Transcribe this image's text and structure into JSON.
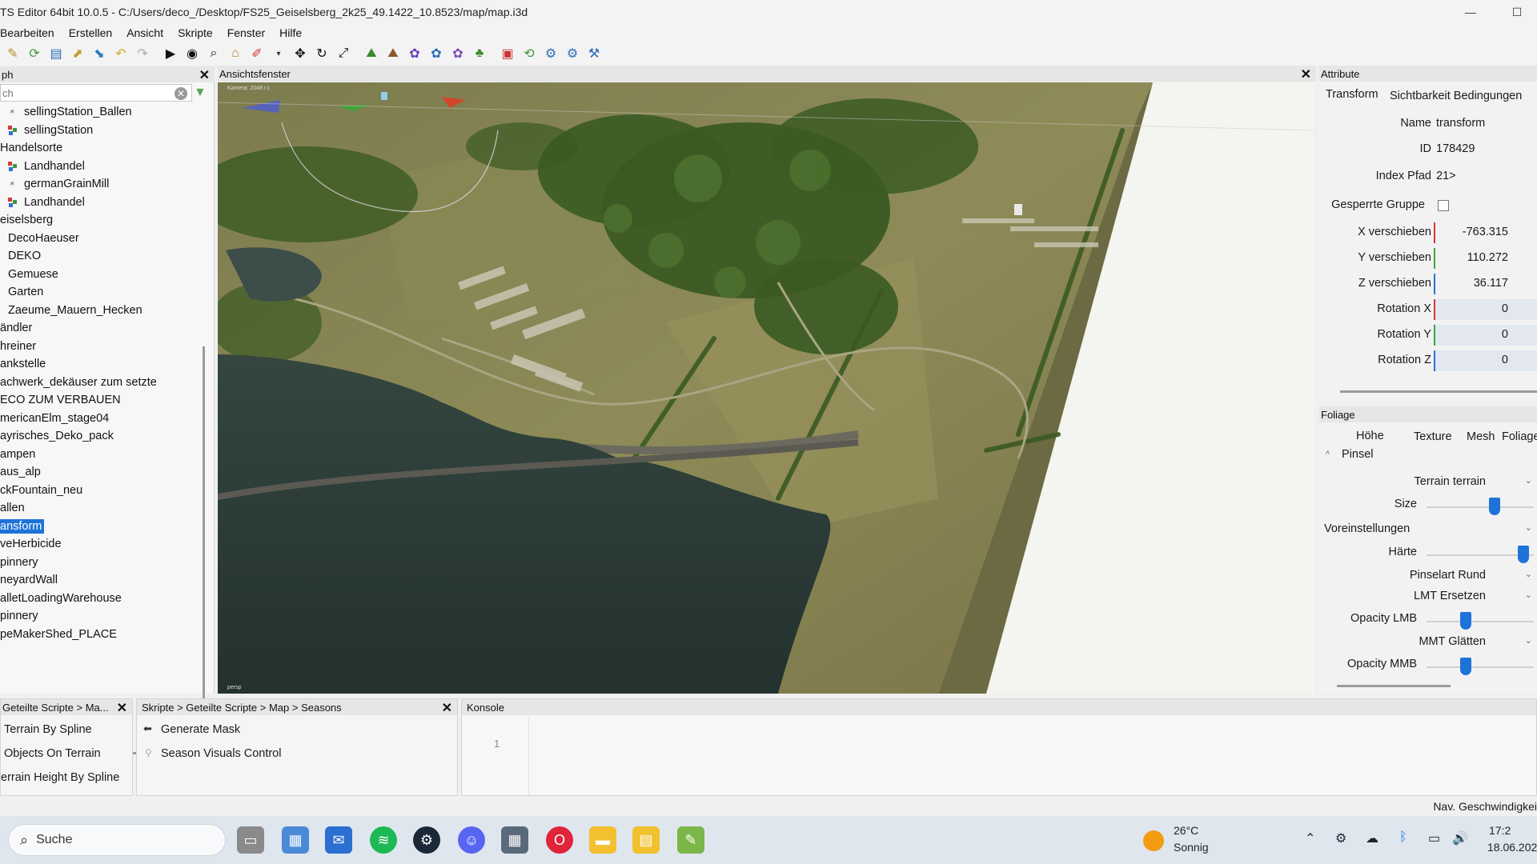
{
  "window": {
    "title": "TS Editor 64bit 10.0.5 - C:/Users/deco_/Desktop/FS25_Geiselsberg_2k25_49.1422_10.8523/map/map.i3d",
    "minimize_glyph": "—",
    "maximize_glyph": "☐"
  },
  "menu": [
    "Bearbeiten",
    "Erstellen",
    "Ansicht",
    "Skripte",
    "Fenster",
    "Hilfe"
  ],
  "scenegraph": {
    "header": "ph",
    "search_placeholder": "ch",
    "items": [
      {
        "label": "sellingStation_Ballen",
        "icon": "leaf"
      },
      {
        "label": "sellingStation",
        "icon": "node"
      },
      {
        "label": "Handelsorte",
        "icon": "none"
      },
      {
        "label": "Landhandel",
        "icon": "node"
      },
      {
        "label": "germanGrainMill",
        "icon": "leaf"
      },
      {
        "label": "Landhandel",
        "icon": "node"
      },
      {
        "label": "eiselsberg",
        "icon": "none"
      },
      {
        "label": "DecoHaeuser",
        "icon": "none"
      },
      {
        "label": "DEKO",
        "icon": "none"
      },
      {
        "label": "Gemuese",
        "icon": "none"
      },
      {
        "label": "Garten",
        "icon": "none"
      },
      {
        "label": "Zaeume_Mauern_Hecken",
        "icon": "none"
      },
      {
        "label": "ändler",
        "icon": "none"
      },
      {
        "label": "hreiner",
        "icon": "none"
      },
      {
        "label": "ankstelle",
        "icon": "none"
      },
      {
        "label": "achwerk_dekäuser zum setzte",
        "icon": "none"
      },
      {
        "label": "ECO ZUM VERBAUEN",
        "icon": "none"
      },
      {
        "label": "mericanElm_stage04",
        "icon": "none"
      },
      {
        "label": "ayrisches_Deko_pack",
        "icon": "none"
      },
      {
        "label": "ampen",
        "icon": "none"
      },
      {
        "label": "aus_alp",
        "icon": "none"
      },
      {
        "label": "ckFountain_neu",
        "icon": "none"
      },
      {
        "label": "allen",
        "icon": "none"
      },
      {
        "label": "ansform",
        "icon": "none",
        "selected": true
      },
      {
        "label": "veHerbicide",
        "icon": "none"
      },
      {
        "label": "pinnery",
        "icon": "none"
      },
      {
        "label": "neyardWall",
        "icon": "none"
      },
      {
        "label": "alletLoadingWarehouse",
        "icon": "none"
      },
      {
        "label": "pinnery",
        "icon": "none"
      },
      {
        "label": "peMakerShed_PLACE",
        "icon": "none"
      }
    ]
  },
  "viewport": {
    "header": "Ansichtsfenster",
    "corner_label_top": "Kamera: 2048 r.c",
    "corner_label_bottom": "persp"
  },
  "attributes": {
    "header": "Attribute",
    "tabs": [
      "Transform",
      "Sichtbarkeit Bedingungen"
    ],
    "name_label": "Name",
    "name_value": "transform",
    "id_label": "ID",
    "id_value": "178429",
    "index_label": "Index Pfad",
    "index_value": "21>",
    "locked_label": "Gesperrte Gruppe",
    "translate": [
      {
        "label": "X verschieben",
        "value": "-763.315",
        "color": "#d23a3a"
      },
      {
        "label": "Y verschieben",
        "value": "110.272",
        "color": "#3aa63a"
      },
      {
        "label": "Z verschieben",
        "value": "36.117",
        "color": "#2f6fd6"
      }
    ],
    "rotation": [
      {
        "label": "Rotation X",
        "value": "0",
        "color": "#d23a3a"
      },
      {
        "label": "Rotation Y",
        "value": "0",
        "color": "#3aa63a"
      },
      {
        "label": "Rotation Z",
        "value": "0",
        "color": "#2f6fd6"
      }
    ]
  },
  "foliage": {
    "header": "Foliage",
    "tabs": [
      "Höhe",
      "Texture",
      "Mesh",
      "Foliage"
    ],
    "section": "Pinsel",
    "terrain_label": "Terrain terrain",
    "size_label": "Size",
    "size_level": 0.65,
    "presets_label": "Voreinstellungen",
    "hardness_label": "Härte",
    "hardness_level": 0.95,
    "brushtype_label": "Pinselart Rund",
    "lmt_label": "LMT Ersetzen",
    "opacity_lmb_label": "Opacity LMB",
    "opacity_lmb_level": 0.35,
    "mmt_label": "MMT Glätten",
    "opacity_mmb_label": "Opacity MMB",
    "opacity_mmb_level": 0.35
  },
  "bottom": {
    "panel1_header": "Geteilte Scripte > Ma...",
    "panel1_items": [
      "Terrain By Spline",
      "Objects On Terrain",
      "errain Height By Spline"
    ],
    "panel2_header": "Skripte > Geteilte Scripte > Map > Seasons",
    "panel2_items": [
      "Generate Mask",
      "Season Visuals Control"
    ],
    "console_header": "Konsole",
    "console_line": "1"
  },
  "status": {
    "right": "Nav. Geschwindigkei"
  },
  "taskbar": {
    "search": "Suche",
    "weather_temp": "26°C",
    "weather_desc": "Sonnig",
    "time": "17:2",
    "date": "18.06.202"
  },
  "colors": {
    "accent": "#1e73d8",
    "water": "#2b3d3c",
    "terrain": "#8c8b55",
    "forest": "#3b5a22"
  }
}
